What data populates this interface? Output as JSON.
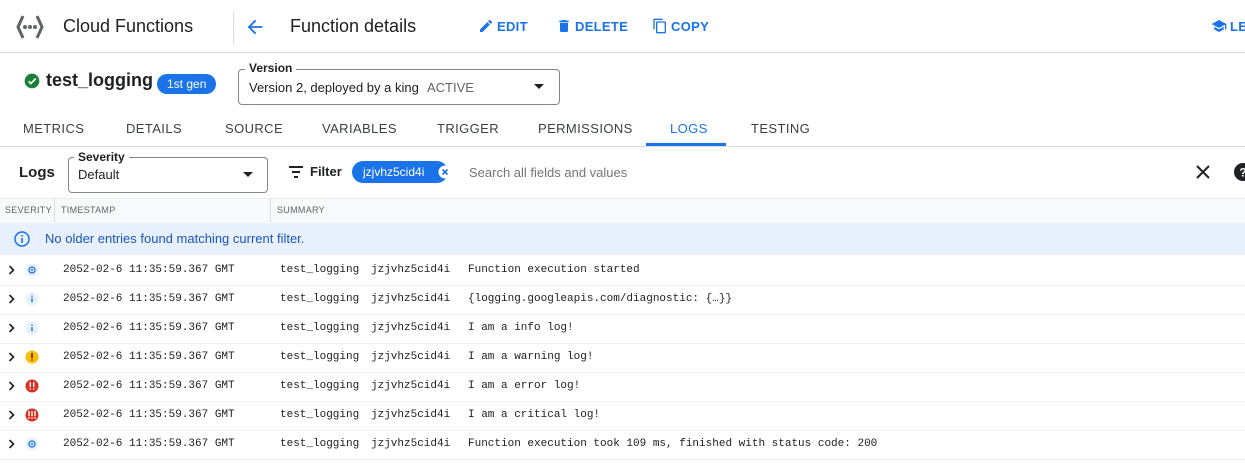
{
  "header": {
    "app_title": "Cloud Functions",
    "page_title": "Function details",
    "actions": {
      "edit": "EDIT",
      "delete": "DELETE",
      "copy": "COPY",
      "learn": "LE"
    }
  },
  "function": {
    "name": "test_logging",
    "generation": "1st gen",
    "version_label": "Version",
    "version_value": "Version 2, deployed by a king",
    "version_status": "ACTIVE"
  },
  "tabs": [
    "METRICS",
    "DETAILS",
    "SOURCE",
    "VARIABLES",
    "TRIGGER",
    "PERMISSIONS",
    "LOGS",
    "TESTING"
  ],
  "active_tab": "LOGS",
  "logs": {
    "label": "Logs",
    "severity_label": "Severity",
    "severity_value": "Default",
    "filter_label": "Filter",
    "filter_chip": "jzjvhz5cid4i",
    "search_placeholder": "Search all fields and values",
    "columns": [
      "SEVERITY",
      "TIMESTAMP",
      "SUMMARY"
    ],
    "info_message": "No older entries found matching current filter.",
    "entries": [
      {
        "severity": "debug",
        "timestamp": "2052-02-6 11:35:59.367 GMT",
        "function": "test_logging",
        "execution_id": "jzjvhz5cid4i",
        "message": "Function execution started"
      },
      {
        "severity": "info",
        "timestamp": "2052-02-6 11:35:59.367 GMT",
        "function": "test_logging",
        "execution_id": "jzjvhz5cid4i",
        "message": "{logging.googleapis.com/diagnostic: {…}}"
      },
      {
        "severity": "info",
        "timestamp": "2052-02-6 11:35:59.367 GMT",
        "function": "test_logging",
        "execution_id": "jzjvhz5cid4i",
        "message": "I am a info log!"
      },
      {
        "severity": "warning",
        "timestamp": "2052-02-6 11:35:59.367 GMT",
        "function": "test_logging",
        "execution_id": "jzjvhz5cid4i",
        "message": "I am a warning log!"
      },
      {
        "severity": "error",
        "timestamp": "2052-02-6 11:35:59.367 GMT",
        "function": "test_logging",
        "execution_id": "jzjvhz5cid4i",
        "message": "I am a error log!"
      },
      {
        "severity": "critical",
        "timestamp": "2052-02-6 11:35:59.367 GMT",
        "function": "test_logging",
        "execution_id": "jzjvhz5cid4i",
        "message": "I am a critical log!"
      },
      {
        "severity": "debug",
        "timestamp": "2052-02-6 11:35:59.367 GMT",
        "function": "test_logging",
        "execution_id": "jzjvhz5cid4i",
        "message": "Function execution took 109 ms, finished with status code: 200"
      }
    ]
  },
  "colors": {
    "accent": "#1a73e8",
    "success": "#188038",
    "warning": "#fbbc04",
    "error": "#d93025",
    "info_banner": "#e8f0fe"
  }
}
